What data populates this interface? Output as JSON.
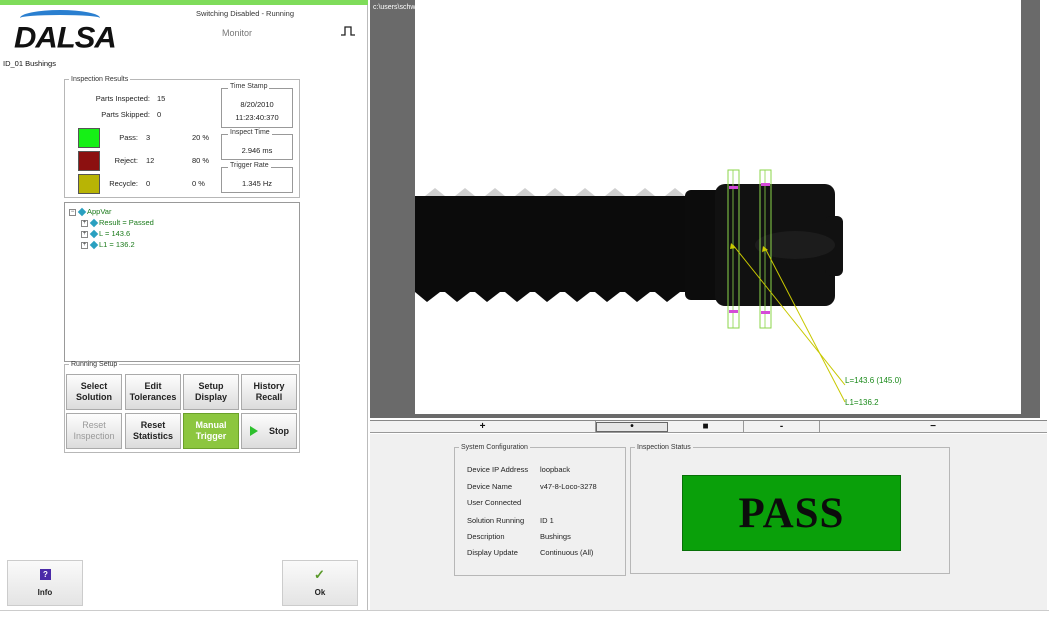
{
  "header": {
    "brand": "DALSA",
    "status": "Switching Disabled - Running",
    "mode": "Monitor",
    "inspection_id": "ID_01  Bushings"
  },
  "inspection_results": {
    "legend": "Inspection Results",
    "parts_inspected_label": "Parts Inspected:",
    "parts_inspected": "15",
    "parts_skipped_label": "Parts Skipped:",
    "parts_skipped": "0",
    "pass_label": "Pass:",
    "pass_count": "3",
    "pass_pct": "20 %",
    "reject_label": "Reject:",
    "reject_count": "12",
    "reject_pct": "80 %",
    "recycle_label": "Recycle:",
    "recycle_count": "0",
    "recycle_pct": "0 %",
    "colors": {
      "pass": "#16f016",
      "reject": "#8c1010",
      "recycle": "#b8b405"
    },
    "time_stamp_label": "Time Stamp",
    "date": "8/20/2010",
    "time": "11:23:40:370",
    "inspect_time_label": "Inspect Time",
    "inspect_time": "2.946 ms",
    "trigger_rate_label": "Trigger Rate",
    "trigger_rate": "1.345 Hz"
  },
  "tree": {
    "root": "AppVar",
    "items": [
      "Result = Passed",
      "L = 143.6",
      "L1 = 136.2"
    ]
  },
  "running_setup": {
    "legend": "Running Setup",
    "select_solution": "Select\nSolution",
    "edit_tolerances": "Edit\nTolerances",
    "setup_display": "Setup\nDisplay",
    "history_recall": "History\nRecall",
    "reset_inspection": "Reset\nInspection",
    "reset_statistics": "Reset\nStatistics",
    "manual_trigger": "Manual\nTrigger",
    "stop": "Stop"
  },
  "footer": {
    "info": "Info",
    "ok": "Ok"
  },
  "viewer": {
    "file_path": "c:\\users\\schwerk\\desktop\\work\\boa app notes\\boa images\\bushing\\good.bmp",
    "measure_l": "L=143.6 (145.0)",
    "measure_l1": "L1=136.2"
  },
  "zoom_bar": {
    "labels": [
      "+",
      "•",
      "■",
      "-",
      "−"
    ]
  },
  "system_config": {
    "legend": "System Configuration",
    "device_ip_label": "Device IP Address",
    "device_ip": "loopback",
    "device_name_label": "Device Name",
    "device_name": "v47-8-Loco-3278",
    "user_connected_label": "User Connected",
    "solution_running_label": "Solution Running",
    "solution_running": "ID 1",
    "description_label": "Description",
    "description": "Bushings",
    "display_update_label": "Display Update",
    "display_update": "Continuous (All)"
  },
  "inspection_status": {
    "legend": "Inspection Status",
    "result": "PASS",
    "color": "#0aa00a"
  }
}
